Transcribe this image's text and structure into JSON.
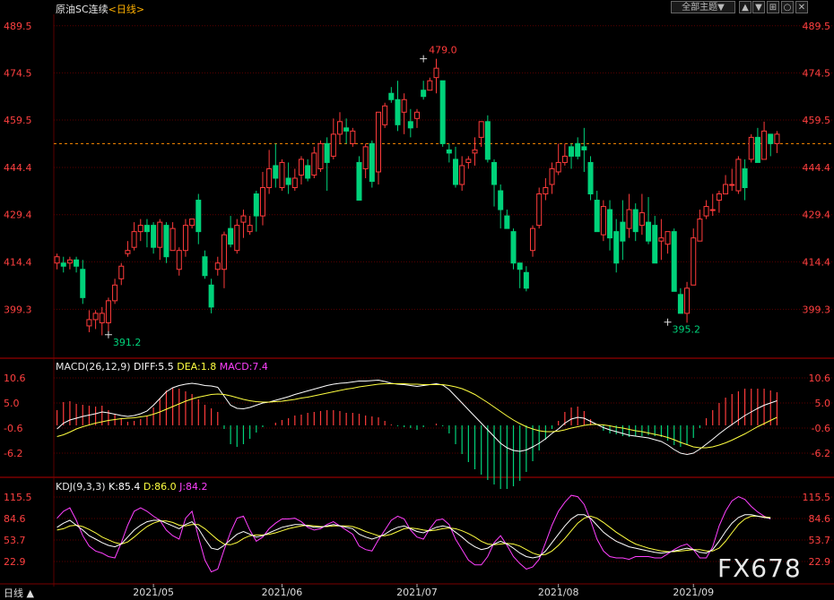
{
  "header": {
    "symbol": "原油SC连续",
    "period": "<日线>",
    "theme_button": "全部主题▼",
    "buttons": [
      "▲",
      "▼",
      "⊞",
      "○",
      "✕"
    ]
  },
  "colors": {
    "up": "#ff3b3b",
    "down": "#00d27a",
    "grid": "#5a0000",
    "axis_text": "#ff4040",
    "diff": "#ffffff",
    "dea": "#ffff40",
    "macd_label": "#ff40ff",
    "k": "#ffffff",
    "d": "#ffff40",
    "j": "#ff40ff"
  },
  "chart_data": [
    {
      "type": "candlestick",
      "title": "原油SC连续<日线>",
      "y_ticks": [
        "489.5",
        "474.5",
        "459.5",
        "444.4",
        "429.4",
        "414.4",
        "399.3"
      ],
      "ylim": [
        386,
        492
      ],
      "current_price_line": 452,
      "annotations": [
        {
          "label": "479.0",
          "x": 57,
          "y": 479.0,
          "kind": "high"
        },
        {
          "label": "391.2",
          "x": 8,
          "y": 391.2,
          "kind": "low"
        },
        {
          "label": "395.2",
          "x": 95,
          "y": 395.2,
          "kind": "low"
        }
      ],
      "x_ticks": [
        {
          "label": "2021/05",
          "index": 15
        },
        {
          "label": "2021/06",
          "index": 35
        },
        {
          "label": "2021/07",
          "index": 56
        },
        {
          "label": "2021/08",
          "index": 78
        },
        {
          "label": "2021/09",
          "index": 99
        }
      ],
      "candles": [
        [
          414,
          416,
          412,
          417
        ],
        [
          414,
          413,
          411,
          416
        ],
        [
          414,
          415,
          412,
          416
        ],
        [
          415,
          413,
          411,
          416
        ],
        [
          412,
          403,
          401,
          415
        ],
        [
          394,
          396,
          392,
          399
        ],
        [
          396,
          398,
          393,
          399
        ],
        [
          395,
          398,
          391,
          400
        ],
        [
          395,
          402,
          392,
          403
        ],
        [
          402,
          407,
          401,
          409
        ],
        [
          409,
          413,
          407,
          414
        ],
        [
          417,
          418,
          416,
          421
        ],
        [
          419,
          424,
          418,
          427
        ],
        [
          424,
          426,
          421,
          428
        ],
        [
          426,
          424,
          419,
          428
        ],
        [
          426,
          419,
          417,
          427
        ],
        [
          419,
          427,
          415,
          428
        ],
        [
          426,
          416,
          414,
          427
        ],
        [
          418,
          425,
          418,
          427
        ],
        [
          412,
          418,
          410,
          419
        ],
        [
          418,
          426,
          416,
          428
        ],
        [
          426,
          428,
          425,
          428
        ],
        [
          434,
          424,
          420,
          436
        ],
        [
          416,
          410,
          409,
          418
        ],
        [
          407,
          400,
          398,
          409
        ],
        [
          412,
          414,
          410,
          416
        ],
        [
          412,
          423,
          406,
          424
        ],
        [
          425,
          420,
          419,
          429
        ],
        [
          418,
          426,
          417,
          428
        ],
        [
          427,
          429,
          422,
          431
        ],
        [
          424,
          426,
          423,
          429
        ],
        [
          436,
          429,
          424,
          437
        ],
        [
          429,
          438,
          426,
          443
        ],
        [
          438,
          444,
          436,
          450
        ],
        [
          445,
          441,
          438,
          452
        ],
        [
          438,
          446,
          437,
          447
        ],
        [
          441,
          439,
          436,
          446
        ],
        [
          438,
          441,
          437,
          444
        ],
        [
          442,
          447,
          439,
          448
        ],
        [
          445,
          441,
          440,
          447
        ],
        [
          442,
          449,
          441,
          451
        ],
        [
          444,
          452,
          443,
          453
        ],
        [
          452,
          446,
          437,
          454
        ],
        [
          448,
          455,
          447,
          460
        ],
        [
          455,
          459,
          452,
          462
        ],
        [
          457,
          456,
          452,
          460
        ],
        [
          452,
          456,
          451,
          457
        ],
        [
          446,
          434,
          434,
          448
        ],
        [
          444,
          451,
          441,
          452
        ],
        [
          452,
          440,
          438,
          453
        ],
        [
          443,
          462,
          439,
          462
        ],
        [
          458,
          464,
          457,
          465
        ],
        [
          468,
          466,
          465,
          470
        ],
        [
          466,
          458,
          456,
          472
        ],
        [
          462,
          466,
          455,
          468
        ],
        [
          459,
          457,
          454,
          463
        ],
        [
          460,
          462,
          457,
          463
        ],
        [
          469,
          467,
          466,
          472
        ],
        [
          469,
          472,
          469,
          473
        ],
        [
          473,
          476,
          468,
          479
        ],
        [
          472,
          452,
          451,
          472
        ],
        [
          450,
          449,
          446,
          452
        ],
        [
          447,
          439,
          438,
          451
        ],
        [
          439,
          445,
          437,
          448
        ],
        [
          446,
          447,
          444,
          448
        ],
        [
          449,
          450,
          445,
          454
        ],
        [
          454,
          459,
          451,
          459
        ],
        [
          459,
          447,
          446,
          461
        ],
        [
          446,
          439,
          432,
          447
        ],
        [
          437,
          431,
          425,
          439
        ],
        [
          429,
          425,
          425,
          431
        ],
        [
          424,
          414,
          412,
          425
        ],
        [
          414,
          412,
          406,
          414
        ],
        [
          411,
          406,
          405,
          413
        ],
        [
          418,
          425,
          416,
          426
        ],
        [
          426,
          436,
          425,
          438
        ],
        [
          436,
          438,
          434,
          441
        ],
        [
          439,
          444,
          436,
          446
        ],
        [
          443,
          446,
          442,
          452
        ],
        [
          446,
          448,
          445,
          452
        ],
        [
          451,
          448,
          444,
          452
        ],
        [
          452,
          448,
          447,
          454
        ],
        [
          451,
          450,
          443,
          457
        ],
        [
          446,
          436,
          434,
          448
        ],
        [
          434,
          424,
          424,
          437
        ],
        [
          423,
          432,
          421,
          434
        ],
        [
          431,
          422,
          418,
          434
        ],
        [
          424,
          414,
          411,
          428
        ],
        [
          427,
          421,
          415,
          434
        ],
        [
          425,
          431,
          422,
          436
        ],
        [
          431,
          424,
          421,
          433
        ],
        [
          426,
          430,
          423,
          436
        ],
        [
          427,
          421,
          420,
          435
        ],
        [
          426,
          414,
          414,
          429
        ],
        [
          421,
          422,
          415,
          428
        ],
        [
          420,
          424,
          417,
          424
        ],
        [
          424,
          405,
          405,
          425
        ],
        [
          404,
          398,
          398,
          406
        ],
        [
          398,
          406,
          395,
          408
        ],
        [
          407,
          422,
          407,
          425
        ],
        [
          421,
          428,
          421,
          431
        ],
        [
          429,
          432,
          428,
          434
        ],
        [
          431,
          431,
          429,
          436
        ],
        [
          434,
          436,
          430,
          437
        ],
        [
          436,
          439,
          436,
          442
        ],
        [
          439,
          439,
          437,
          444
        ],
        [
          437,
          447,
          436,
          448
        ],
        [
          444,
          438,
          434,
          447
        ],
        [
          447,
          454,
          446,
          455
        ],
        [
          454,
          446,
          446,
          457
        ],
        [
          447,
          456,
          448,
          459
        ],
        [
          455,
          452,
          448,
          455
        ],
        [
          452,
          455,
          449,
          456
        ]
      ]
    },
    {
      "type": "macd",
      "title": "MACD(26,12,9)",
      "legend": [
        {
          "label": "DIFF:5.5",
          "color": "#ffffff"
        },
        {
          "label": "DEA:1.8",
          "color": "#ffff40"
        },
        {
          "label": "MACD:7.4",
          "color": "#ff40ff"
        }
      ],
      "y_ticks": [
        "10.6",
        "5.0",
        "-0.6",
        "-6.2"
      ],
      "ylim": [
        -9,
        12
      ],
      "diff": [
        -0.8,
        0.5,
        1.2,
        1.6,
        2.0,
        2.3,
        2.6,
        3.0,
        2.8,
        2.5,
        2.2,
        2.0,
        2.2,
        2.6,
        3.2,
        4.5,
        6.0,
        7.5,
        8.4,
        8.9,
        9.2,
        9.4,
        9.2,
        8.9,
        8.8,
        8.5,
        6.5,
        4.5,
        3.8,
        3.7,
        4.0,
        4.5,
        5.0,
        5.2,
        5.6,
        6.0,
        6.4,
        6.9,
        7.3,
        7.7,
        8.1,
        8.5,
        8.9,
        9.2,
        9.4,
        9.5,
        9.7,
        9.9,
        9.9,
        10.0,
        10.1,
        9.8,
        9.4,
        9.2,
        9.1,
        8.9,
        8.7,
        8.9,
        9.1,
        9.3,
        9.0,
        8.0,
        6.5,
        5.0,
        3.5,
        2.0,
        0.5,
        -1.0,
        -2.5,
        -4.0,
        -5.0,
        -5.6,
        -5.8,
        -5.5,
        -4.8,
        -4.0,
        -3.0,
        -1.8,
        -0.8,
        0.5,
        1.4,
        1.8,
        1.6,
        0.9,
        0.2,
        -0.5,
        -1.0,
        -1.4,
        -1.8,
        -2.2,
        -2.4,
        -2.6,
        -2.8,
        -3.2,
        -3.6,
        -4.4,
        -5.4,
        -6.2,
        -6.5,
        -6.2,
        -5.3,
        -4.2,
        -3.1,
        -1.9,
        -0.8,
        0.2,
        1.2,
        2.2,
        3.0,
        3.8,
        4.5,
        5.0,
        5.5
      ],
      "dea": [
        -2.5,
        -2.1,
        -1.5,
        -0.8,
        -0.3,
        0.1,
        0.5,
        0.8,
        1.1,
        1.3,
        1.5,
        1.6,
        1.7,
        1.9,
        2.1,
        2.5,
        3.0,
        3.6,
        4.2,
        4.8,
        5.4,
        5.9,
        6.3,
        6.6,
        6.9,
        7.0,
        6.9,
        6.6,
        6.2,
        5.8,
        5.5,
        5.3,
        5.2,
        5.2,
        5.3,
        5.4,
        5.6,
        5.8,
        6.1,
        6.3,
        6.6,
        6.9,
        7.2,
        7.5,
        7.8,
        8.1,
        8.3,
        8.6,
        8.8,
        9.0,
        9.2,
        9.3,
        9.3,
        9.3,
        9.3,
        9.2,
        9.2,
        9.1,
        9.1,
        9.1,
        9.1,
        8.9,
        8.6,
        8.2,
        7.6,
        6.9,
        6.0,
        5.1,
        4.1,
        3.1,
        2.1,
        1.2,
        0.4,
        -0.3,
        -0.8,
        -1.2,
        -1.4,
        -1.4,
        -1.3,
        -1.0,
        -0.6,
        -0.3,
        0.0,
        0.2,
        0.2,
        0.1,
        -0.1,
        -0.4,
        -0.6,
        -0.9,
        -1.2,
        -1.4,
        -1.7,
        -2.0,
        -2.3,
        -2.7,
        -3.2,
        -3.8,
        -4.3,
        -4.8,
        -5.0,
        -5.0,
        -4.8,
        -4.4,
        -3.9,
        -3.3,
        -2.6,
        -1.9,
        -1.1,
        -0.3,
        0.4,
        1.1,
        1.8
      ]
    },
    {
      "type": "kdj",
      "title": "KDJ(9,3,3)",
      "legend": [
        {
          "label": "K:85.4",
          "color": "#ffffff"
        },
        {
          "label": "D:86.0",
          "color": "#ffff40"
        },
        {
          "label": "J:84.2",
          "color": "#ff40ff"
        }
      ],
      "y_ticks": [
        "115.5",
        "84.6",
        "53.7",
        "22.9"
      ],
      "ylim": [
        5,
        125
      ],
      "k": [
        72,
        78,
        82,
        75,
        68,
        60,
        55,
        50,
        46,
        44,
        48,
        58,
        68,
        75,
        80,
        82,
        82,
        78,
        74,
        70,
        76,
        80,
        70,
        55,
        42,
        40,
        46,
        54,
        62,
        66,
        62,
        58,
        60,
        64,
        68,
        72,
        74,
        76,
        76,
        74,
        72,
        72,
        74,
        76,
        74,
        72,
        70,
        62,
        58,
        55,
        58,
        62,
        68,
        72,
        74,
        70,
        66,
        64,
        68,
        72,
        74,
        72,
        65,
        58,
        50,
        44,
        40,
        42,
        48,
        52,
        48,
        42,
        35,
        30,
        28,
        30,
        38,
        50,
        62,
        74,
        84,
        90,
        90,
        85,
        75,
        65,
        58,
        52,
        48,
        44,
        42,
        40,
        38,
        36,
        35,
        36,
        38,
        40,
        42,
        40,
        36,
        35,
        40,
        52,
        66,
        78,
        86,
        90,
        90,
        88,
        86,
        85
      ],
      "d": [
        68,
        70,
        74,
        75,
        73,
        69,
        64,
        58,
        54,
        50,
        48,
        51,
        58,
        66,
        73,
        78,
        81,
        81,
        79,
        75,
        74,
        76,
        76,
        70,
        62,
        54,
        48,
        47,
        50,
        56,
        60,
        61,
        61,
        62,
        64,
        67,
        70,
        72,
        74,
        75,
        74,
        73,
        73,
        74,
        74,
        74,
        73,
        70,
        66,
        63,
        60,
        60,
        62,
        66,
        70,
        71,
        70,
        68,
        67,
        68,
        70,
        71,
        70,
        67,
        63,
        58,
        52,
        48,
        47,
        48,
        49,
        48,
        45,
        40,
        35,
        32,
        33,
        38,
        46,
        56,
        67,
        78,
        85,
        88,
        85,
        79,
        72,
        65,
        59,
        53,
        48,
        45,
        42,
        40,
        38,
        37,
        37,
        38,
        39,
        40,
        40,
        38,
        38,
        42,
        52,
        64,
        76,
        84,
        88,
        88,
        87,
        86
      ],
      "j": [
        85,
        95,
        100,
        82,
        60,
        45,
        38,
        35,
        30,
        28,
        50,
        75,
        95,
        100,
        95,
        88,
        82,
        68,
        60,
        55,
        85,
        95,
        58,
        25,
        5,
        12,
        40,
        65,
        85,
        88,
        68,
        52,
        58,
        70,
        78,
        84,
        84,
        85,
        80,
        72,
        68,
        70,
        76,
        80,
        74,
        68,
        62,
        45,
        40,
        38,
        54,
        68,
        82,
        88,
        84,
        68,
        58,
        55,
        70,
        82,
        84,
        76,
        55,
        40,
        25,
        18,
        18,
        30,
        50,
        60,
        46,
        30,
        20,
        12,
        15,
        26,
        50,
        75,
        95,
        108,
        118,
        116,
        105,
        82,
        55,
        38,
        30,
        28,
        28,
        26,
        30,
        30,
        30,
        28,
        28,
        34,
        40,
        45,
        48,
        40,
        28,
        28,
        44,
        74,
        95,
        110,
        116,
        112,
        102,
        94,
        88,
        84
      ]
    },
    {
      "type": "watermark",
      "text": "FX678"
    }
  ],
  "footer": {
    "tab_label": "日线 ▲"
  }
}
